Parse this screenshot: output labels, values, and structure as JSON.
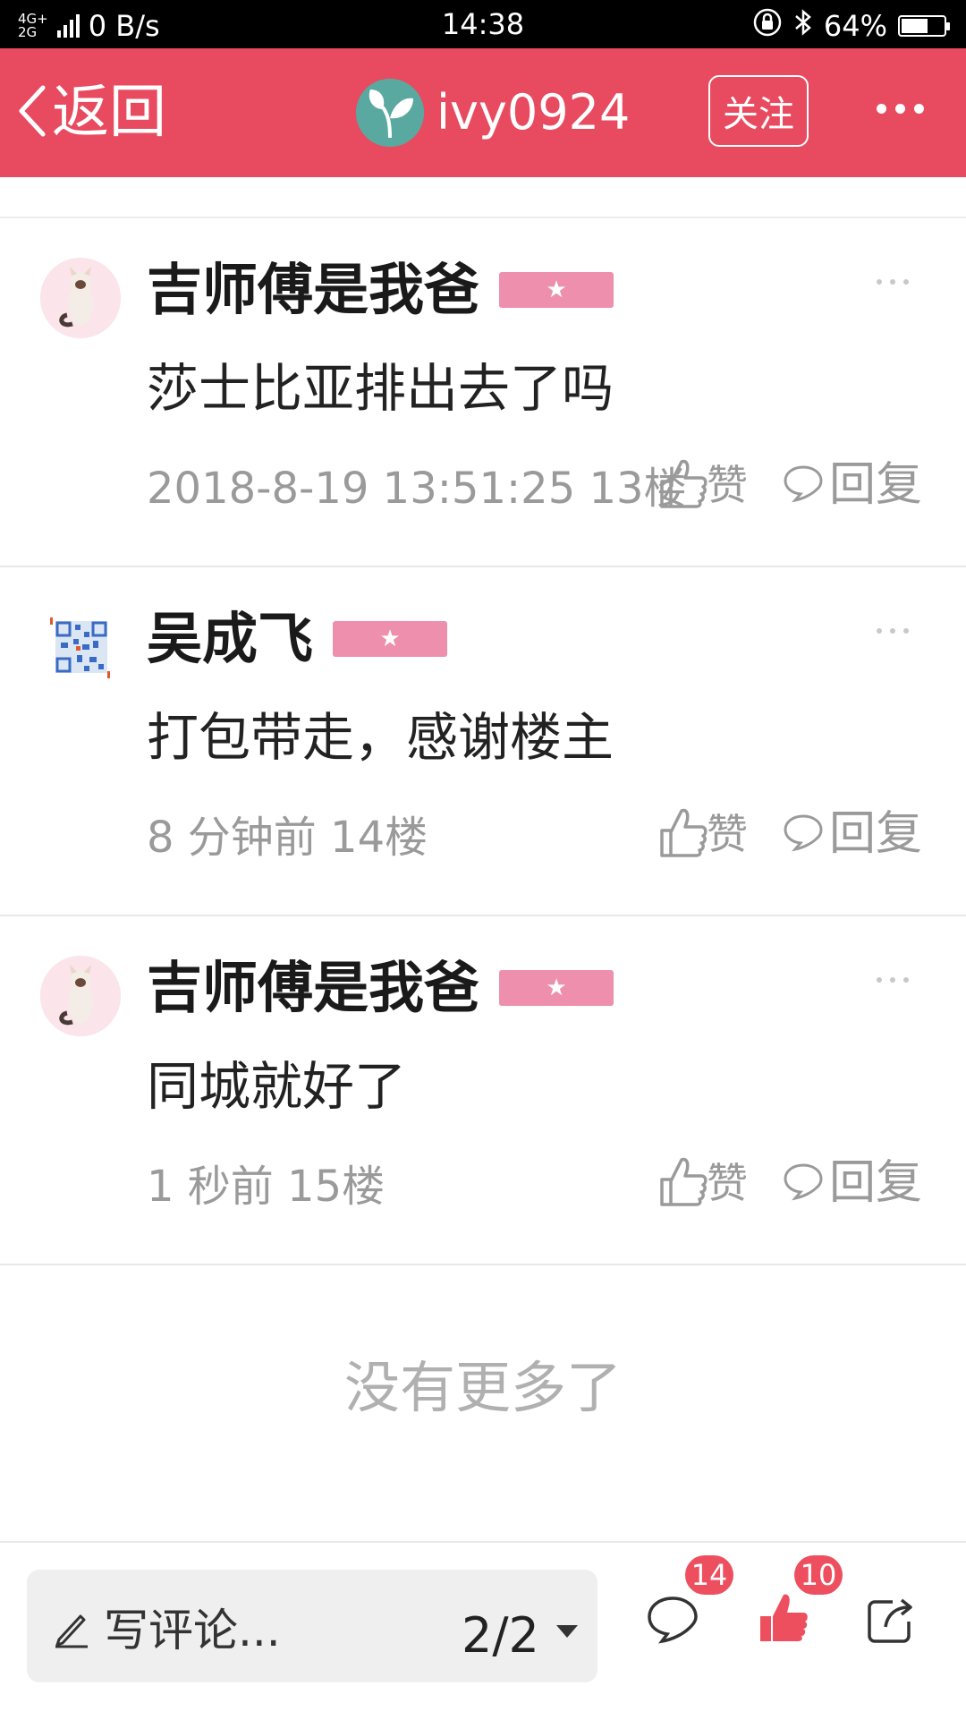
{
  "status_bar": {
    "network_gen_top": "4G+",
    "network_gen_bottom": "2G",
    "speed": "0 B/s",
    "time": "14:38",
    "battery_percent": "64%",
    "battery_level": 0.64
  },
  "nav": {
    "back_label": "返回",
    "username": "ivy0924",
    "follow_label": "关注",
    "accent_color": "#e84a5f"
  },
  "comments": [
    {
      "user": "吉师傅是我爸",
      "avatar": "cat-avatar",
      "text": "莎士比亚排出去了吗",
      "meta": "2018-8-19 13:51:25 13楼",
      "like_label": "赞",
      "reply_label": "回复"
    },
    {
      "user": "吴成飞",
      "avatar": "qr-code-avatar",
      "text": "打包带走，感谢楼主",
      "meta": "8 分钟前 14楼",
      "like_label": "赞",
      "reply_label": "回复"
    },
    {
      "user": "吉师傅是我爸",
      "avatar": "cat-avatar",
      "text": "同城就好了",
      "meta": "1 秒前 15楼",
      "like_label": "赞",
      "reply_label": "回复"
    }
  ],
  "no_more_text": "没有更多了",
  "bottom_bar": {
    "comment_placeholder": "写评论...",
    "page_indicator": "2/2",
    "comments_count": "14",
    "likes_count": "10"
  }
}
